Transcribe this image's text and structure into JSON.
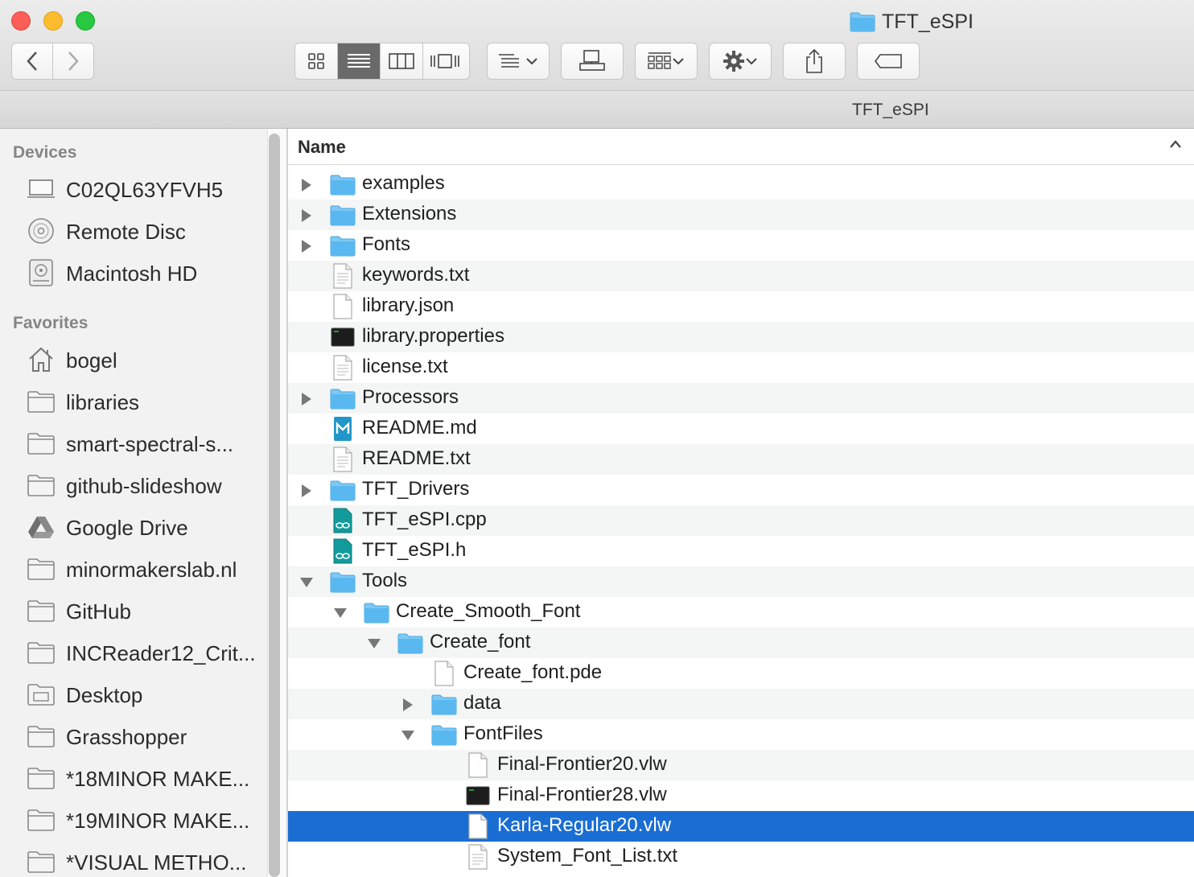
{
  "window": {
    "title": "TFT_eSPI"
  },
  "toolbar": {
    "back_icon": "chevron-left-icon",
    "forward_icon": "chevron-right-icon",
    "views": [
      "icon-view",
      "list-view",
      "column-view",
      "cover-flow-view"
    ],
    "active_view": "list-view"
  },
  "pathbar": {
    "text": "TFT_eSPI"
  },
  "sidebar": {
    "devices_heading": "Devices",
    "devices": [
      {
        "label": "C02QL63YFVH5",
        "icon": "laptop-icon"
      },
      {
        "label": "Remote Disc",
        "icon": "disc-icon"
      },
      {
        "label": "Macintosh HD",
        "icon": "hard-drive-icon"
      }
    ],
    "favorites_heading": "Favorites",
    "favorites": [
      {
        "label": "bogel",
        "icon": "home-icon"
      },
      {
        "label": "libraries",
        "icon": "folder-icon"
      },
      {
        "label": "smart-spectral-s...",
        "icon": "folder-icon"
      },
      {
        "label": "github-slideshow",
        "icon": "folder-icon"
      },
      {
        "label": "Google Drive",
        "icon": "google-drive-icon"
      },
      {
        "label": "minormakerslab.nl",
        "icon": "folder-icon"
      },
      {
        "label": "GitHub",
        "icon": "folder-icon"
      },
      {
        "label": "INCReader12_Crit...",
        "icon": "folder-icon"
      },
      {
        "label": "Desktop",
        "icon": "desktop-folder-icon"
      },
      {
        "label": "Grasshopper",
        "icon": "folder-icon"
      },
      {
        "label": "*18MINOR MAKE...",
        "icon": "folder-icon"
      },
      {
        "label": "*19MINOR MAKE...",
        "icon": "folder-icon"
      },
      {
        "label": "*VISUAL METHO...",
        "icon": "folder-icon"
      }
    ]
  },
  "list": {
    "column_name": "Name",
    "sort_direction": "ascending",
    "rows": [
      {
        "name": "examples",
        "type": "folder",
        "depth": 0,
        "disclosure": "collapsed"
      },
      {
        "name": "Extensions",
        "type": "folder",
        "depth": 0,
        "disclosure": "collapsed"
      },
      {
        "name": "Fonts",
        "type": "folder",
        "depth": 0,
        "disclosure": "collapsed"
      },
      {
        "name": "keywords.txt",
        "type": "text-doc",
        "depth": 0,
        "disclosure": "none"
      },
      {
        "name": "library.json",
        "type": "blank-doc",
        "depth": 0,
        "disclosure": "none"
      },
      {
        "name": "library.properties",
        "type": "exec",
        "depth": 0,
        "disclosure": "none"
      },
      {
        "name": "license.txt",
        "type": "text-doc",
        "depth": 0,
        "disclosure": "none"
      },
      {
        "name": "Processors",
        "type": "folder",
        "depth": 0,
        "disclosure": "collapsed"
      },
      {
        "name": "README.md",
        "type": "markdown",
        "depth": 0,
        "disclosure": "none"
      },
      {
        "name": "README.txt",
        "type": "text-doc",
        "depth": 0,
        "disclosure": "none"
      },
      {
        "name": "TFT_Drivers",
        "type": "folder",
        "depth": 0,
        "disclosure": "collapsed"
      },
      {
        "name": "TFT_eSPI.cpp",
        "type": "arduino",
        "depth": 0,
        "disclosure": "none"
      },
      {
        "name": "TFT_eSPI.h",
        "type": "arduino",
        "depth": 0,
        "disclosure": "none"
      },
      {
        "name": "Tools",
        "type": "folder",
        "depth": 0,
        "disclosure": "expanded"
      },
      {
        "name": "Create_Smooth_Font",
        "type": "folder",
        "depth": 1,
        "disclosure": "expanded"
      },
      {
        "name": "Create_font",
        "type": "folder",
        "depth": 2,
        "disclosure": "expanded"
      },
      {
        "name": "Create_font.pde",
        "type": "blank-doc",
        "depth": 3,
        "disclosure": "none"
      },
      {
        "name": "data",
        "type": "folder",
        "depth": 3,
        "disclosure": "collapsed"
      },
      {
        "name": "FontFiles",
        "type": "folder",
        "depth": 3,
        "disclosure": "expanded"
      },
      {
        "name": "Final-Frontier20.vlw",
        "type": "blank-doc",
        "depth": 4,
        "disclosure": "none"
      },
      {
        "name": "Final-Frontier28.vlw",
        "type": "exec",
        "depth": 4,
        "disclosure": "none"
      },
      {
        "name": "Karla-Regular20.vlw",
        "type": "blank-doc",
        "depth": 4,
        "disclosure": "none",
        "selected": true
      },
      {
        "name": "System_Font_List.txt",
        "type": "text-doc",
        "depth": 4,
        "disclosure": "none"
      }
    ]
  },
  "colors": {
    "selection": "#1a6dd3",
    "folder": "#5ab8f0"
  }
}
